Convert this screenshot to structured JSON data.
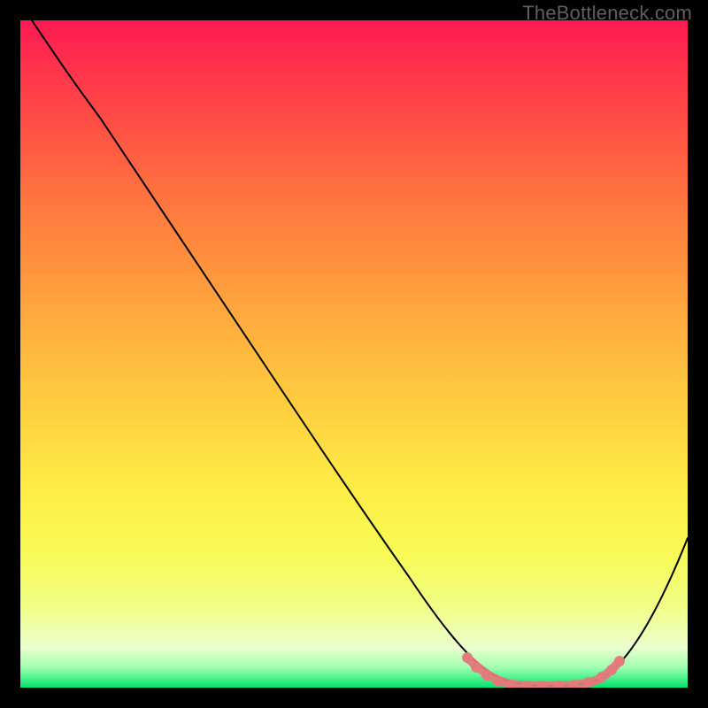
{
  "watermark": "TheBottleneck.com",
  "colors": {
    "frame": "#000000",
    "curve": "#000000",
    "highlight": "#e47a7a",
    "gradient_top": "#ff1a52",
    "gradient_mid": "#ffd942",
    "gradient_bottom": "#00e46e"
  },
  "chart_data": {
    "type": "line",
    "title": "",
    "xlabel": "",
    "ylabel": "",
    "xlim": [
      0,
      100
    ],
    "ylim": [
      0,
      100
    ],
    "series": [
      {
        "name": "bottleneck-curve",
        "x": [
          0,
          5,
          10,
          15,
          20,
          25,
          30,
          35,
          40,
          45,
          50,
          55,
          60,
          65,
          70,
          73,
          76,
          79,
          82,
          85,
          88,
          92,
          96,
          100
        ],
        "values": [
          100,
          95,
          89,
          83,
          77,
          70,
          63,
          56,
          49,
          42,
          35,
          28,
          21,
          14,
          7,
          3,
          1,
          0,
          0,
          0,
          1,
          5,
          13,
          23
        ]
      }
    ],
    "highlight_range_x": [
      70,
      88
    ],
    "annotations": []
  }
}
